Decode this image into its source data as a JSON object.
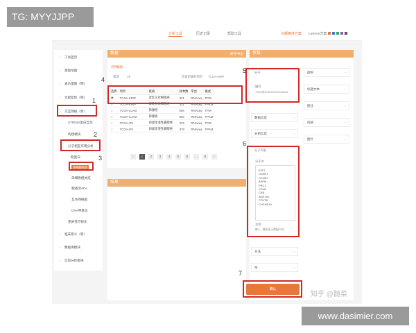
{
  "watermarks": {
    "top": "TG: MYYJJPP",
    "bottom": "www.dasimier.com",
    "zhihu": "知乎 @髄菜"
  },
  "topnav": {
    "tabs": [
      "分析工具",
      "历史记录",
      "帮助工具"
    ],
    "solution": "合都莱佳方案",
    "user": "Lenovo方案"
  },
  "sidebar": {
    "items": [
      "工具首页",
      "基础绘图",
      "表达量图（网）",
      "文献复现（网）",
      "交互网络（新）",
      "STRING蛋白互作",
      "构建模块",
      "分子相互作用分析",
      "靶蛋白",
      "单细胞相关",
      "单细胞相关拓",
      "靶基因-RN...",
      "互作网络图",
      "DNA甲基化",
      "相关性可视化",
      "临床意义（新）",
      "数据库模块",
      "实验分析模块"
    ],
    "highlighted": "单细胞相关"
  },
  "data_panel": {
    "title": "数据",
    "action": "保存/导出",
    "sample_link": "示例数据",
    "filter_label1": "来源",
    "filter_value1": "All",
    "filter_label2": "检索结果的项目",
    "filter_value2": "TCGA-KIRP",
    "columns": [
      "选择",
      "项目",
      "疾病",
      "样本数",
      "平台",
      "格式"
    ],
    "rows": [
      [
        "TCGA-KIRP",
        "肾乳头状细胞癌",
        "321",
        "RNAseq",
        "TPM"
      ],
      [
        "TCGA-KIRP",
        "肾乳头状细胞癌",
        "321",
        "RNAseq",
        "FPKM"
      ],
      [
        "TCGA-LUAD",
        "肺腺癌",
        "594",
        "RNAseq",
        "TPM"
      ],
      [
        "TCGA-LUAD",
        "肺腺癌",
        "594",
        "RNAseq",
        "FPKM"
      ],
      [
        "TCGA-OV",
        "卵巢浆液性囊腺癌",
        "379",
        "RNAseq",
        "TPM"
      ],
      [
        "TCGA-OV",
        "卵巢浆液性囊腺癌",
        "379",
        "RNAseq",
        "FPKM"
      ]
    ],
    "pages": [
      "1",
      "2",
      "3",
      "4",
      "5",
      "6",
      "...",
      "9"
    ]
  },
  "result_panel": {
    "title": "结果"
  },
  "params_panel": {
    "title": "参数",
    "molecule": "分子",
    "molecule_field_label": "编码",
    "molecule_field_value": "TSC6对ENSG00000145034",
    "mod_info": "数据信息",
    "grouping": "分组信息",
    "mol_list": "分子列表",
    "mol_list_label": "分子ID",
    "genes": [
      "E2F7",
      "CDNF1",
      "CCNE2",
      "ASPM",
      "PRC1",
      "CDH2",
      "CKB",
      "AKR1A1",
      "PTHTB",
      "CHCHD10"
    ],
    "note_label": "其他",
    "note_placeholder": "输入 - 最多显示数据50项",
    "method": "方法",
    "other": "柱",
    "color": "颜色",
    "title_text": "标题文本",
    "legend": "图注",
    "style": "风格",
    "facet": "图片",
    "submit": "确认"
  },
  "annotations": [
    "1",
    "2",
    "3",
    "4",
    "5",
    "6",
    "7"
  ]
}
